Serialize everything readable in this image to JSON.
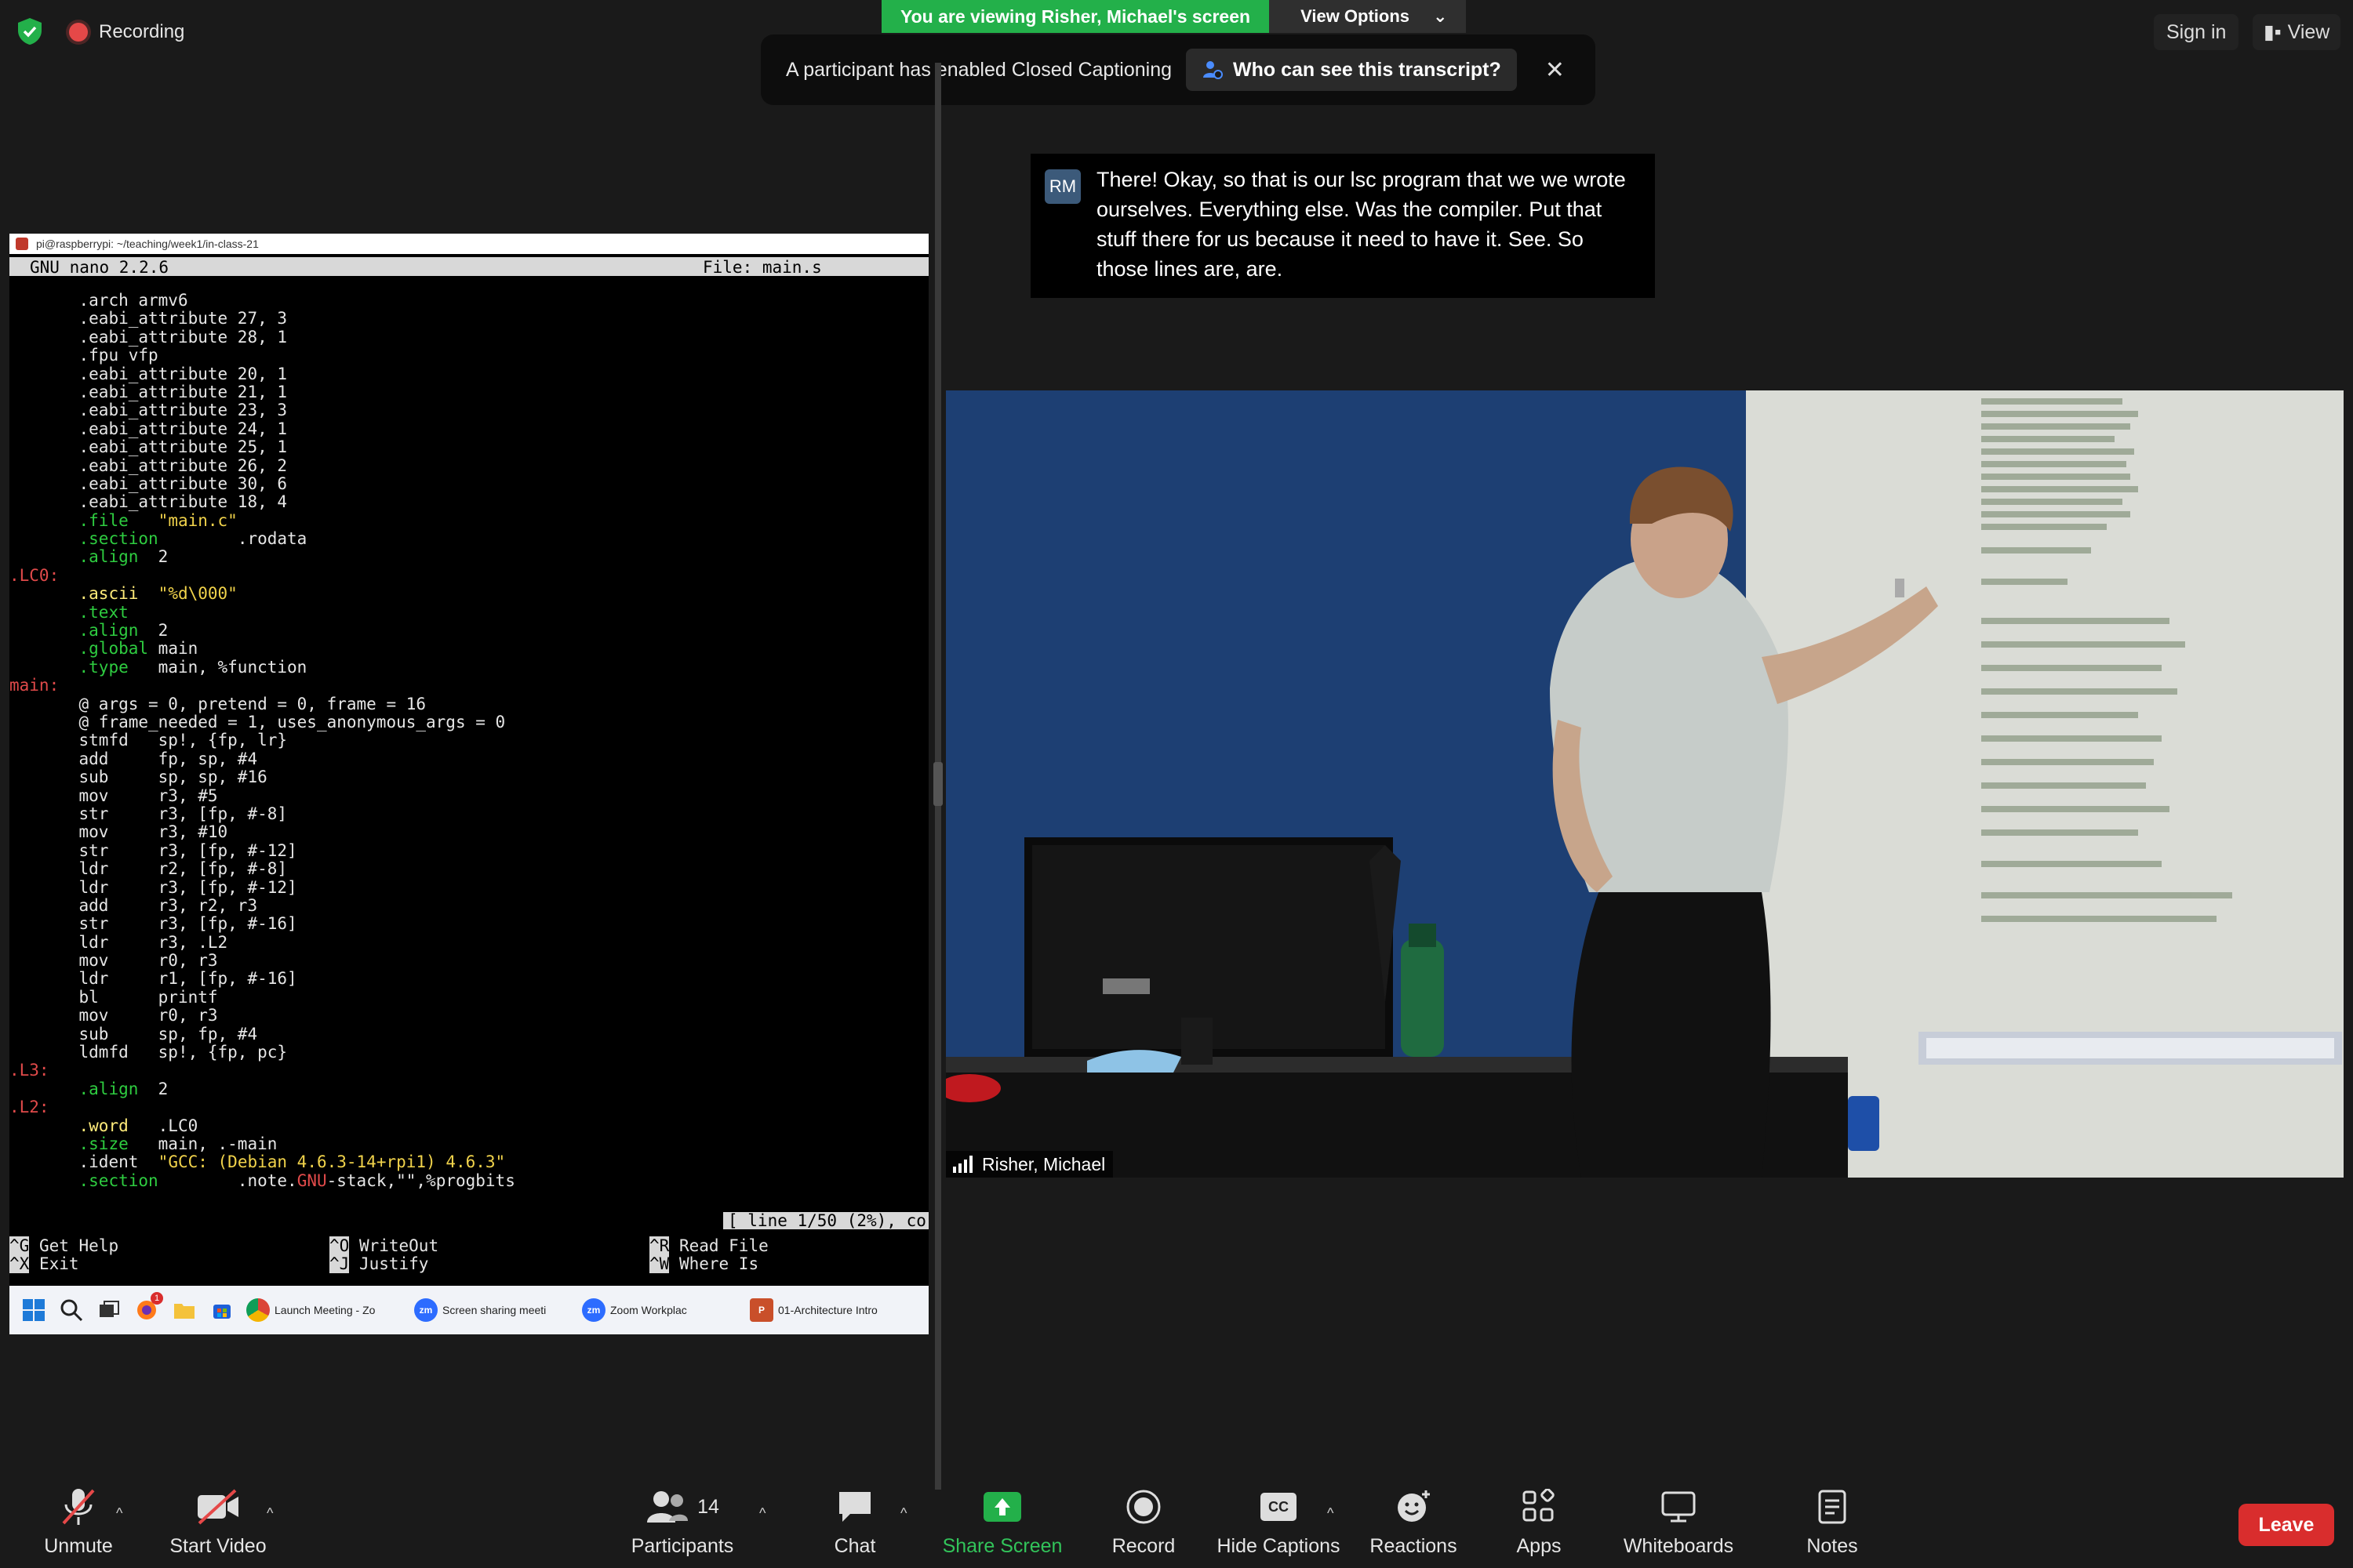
{
  "top": {
    "recording_label": "Recording",
    "viewing_banner": "You are viewing Risher, Michael's screen",
    "view_options": "View Options",
    "cc_notice": "A participant has enabled Closed Captioning",
    "cc_who": "Who can see this transcript?",
    "signin": "Sign in",
    "view": "View"
  },
  "terminal": {
    "title": "pi@raspberrypi: ~/teaching/week1/in-class-21",
    "nano_version": "GNU nano 2.2.6",
    "file": "File: main.s",
    "lines": [
      [
        [
          "",
          "       "
        ],
        [
          "t",
          ".arch armv6"
        ]
      ],
      [
        [
          "",
          "       "
        ],
        [
          "t",
          ".eabi_attribute 27, 3"
        ]
      ],
      [
        [
          "",
          "       "
        ],
        [
          "t",
          ".eabi_attribute 28, 1"
        ]
      ],
      [
        [
          "",
          "       "
        ],
        [
          "t",
          ".fpu vfp"
        ]
      ],
      [
        [
          "",
          "       "
        ],
        [
          "t",
          ".eabi_attribute 20, 1"
        ]
      ],
      [
        [
          "",
          "       "
        ],
        [
          "t",
          ".eabi_attribute 21, 1"
        ]
      ],
      [
        [
          "",
          "       "
        ],
        [
          "t",
          ".eabi_attribute 23, 3"
        ]
      ],
      [
        [
          "",
          "       "
        ],
        [
          "t",
          ".eabi_attribute 24, 1"
        ]
      ],
      [
        [
          "",
          "       "
        ],
        [
          "t",
          ".eabi_attribute 25, 1"
        ]
      ],
      [
        [
          "",
          "       "
        ],
        [
          "t",
          ".eabi_attribute 26, 2"
        ]
      ],
      [
        [
          "",
          "       "
        ],
        [
          "t",
          ".eabi_attribute 30, 6"
        ]
      ],
      [
        [
          "",
          "       "
        ],
        [
          "t",
          ".eabi_attribute 18, 4"
        ]
      ],
      [
        [
          "",
          "       "
        ],
        [
          "dir",
          ".file"
        ],
        [
          "t",
          "   "
        ],
        [
          "str",
          "\"main.c\""
        ]
      ],
      [
        [
          "",
          "       "
        ],
        [
          "dir",
          ".section"
        ],
        [
          "t",
          "        .rodata"
        ]
      ],
      [
        [
          "",
          "       "
        ],
        [
          "dir",
          ".align"
        ],
        [
          "t",
          "  2"
        ]
      ],
      [
        [
          "lab",
          ".LC0:"
        ]
      ],
      [
        [
          "",
          "       "
        ],
        [
          "kw",
          ".ascii"
        ],
        [
          "t",
          "  "
        ],
        [
          "str",
          "\"%d\\000\""
        ]
      ],
      [
        [
          "",
          "       "
        ],
        [
          "dir",
          ".text"
        ]
      ],
      [
        [
          "",
          "       "
        ],
        [
          "dir",
          ".align"
        ],
        [
          "t",
          "  2"
        ]
      ],
      [
        [
          "",
          "       "
        ],
        [
          "dir",
          ".global"
        ],
        [
          "t",
          " main"
        ]
      ],
      [
        [
          "",
          "       "
        ],
        [
          "dir",
          ".type"
        ],
        [
          "t",
          "   main, %function"
        ]
      ],
      [
        [
          "lab",
          "main:"
        ]
      ],
      [
        [
          "",
          "       "
        ],
        [
          "t",
          "@ args = 0, pretend = 0, frame = 16"
        ]
      ],
      [
        [
          "",
          "       "
        ],
        [
          "t",
          "@ frame_needed = 1, uses_anonymous_args = 0"
        ]
      ],
      [
        [
          "",
          "       "
        ],
        [
          "t",
          "stmfd   sp!, {fp, lr}"
        ]
      ],
      [
        [
          "",
          "       "
        ],
        [
          "t",
          "add     fp, sp, #4"
        ]
      ],
      [
        [
          "",
          "       "
        ],
        [
          "t",
          "sub     sp, sp, #16"
        ]
      ],
      [
        [
          "",
          "       "
        ],
        [
          "t",
          "mov     r3, #5"
        ]
      ],
      [
        [
          "",
          "       "
        ],
        [
          "t",
          "str     r3, [fp, #-8]"
        ]
      ],
      [
        [
          "",
          "       "
        ],
        [
          "t",
          "mov     r3, #10"
        ]
      ],
      [
        [
          "",
          "       "
        ],
        [
          "t",
          "str     r3, [fp, #-12]"
        ]
      ],
      [
        [
          "",
          "       "
        ],
        [
          "t",
          "ldr     r2, [fp, #-8]"
        ]
      ],
      [
        [
          "",
          "       "
        ],
        [
          "t",
          "ldr     r3, [fp, #-12]"
        ]
      ],
      [
        [
          "",
          "       "
        ],
        [
          "t",
          "add     r3, r2, r3"
        ]
      ],
      [
        [
          "",
          "       "
        ],
        [
          "t",
          "str     r3, [fp, #-16]"
        ]
      ],
      [
        [
          "",
          "       "
        ],
        [
          "t",
          "ldr     r3, .L2"
        ]
      ],
      [
        [
          "",
          "       "
        ],
        [
          "t",
          "mov     r0, r3"
        ]
      ],
      [
        [
          "",
          "       "
        ],
        [
          "t",
          "ldr     r1, [fp, #-16]"
        ]
      ],
      [
        [
          "",
          "       "
        ],
        [
          "t",
          "bl      printf"
        ]
      ],
      [
        [
          "",
          "       "
        ],
        [
          "t",
          "mov     r0, r3"
        ]
      ],
      [
        [
          "",
          "       "
        ],
        [
          "t",
          "sub     sp, fp, #4"
        ]
      ],
      [
        [
          "",
          "       "
        ],
        [
          "t",
          "ldmfd   sp!, {fp, pc}"
        ]
      ],
      [
        [
          "lab",
          ".L3:"
        ]
      ],
      [
        [
          "",
          "       "
        ],
        [
          "dir",
          ".align"
        ],
        [
          "t",
          "  2"
        ]
      ],
      [
        [
          "lab",
          ".L2:"
        ]
      ],
      [
        [
          "",
          "       "
        ],
        [
          "kw",
          ".word"
        ],
        [
          "t",
          "   .LC0"
        ]
      ],
      [
        [
          "",
          "       "
        ],
        [
          "dir",
          ".size"
        ],
        [
          "t",
          "   main, .-main"
        ]
      ],
      [
        [
          "",
          "       "
        ],
        [
          "t",
          ".ident  "
        ],
        [
          "str",
          "\"GCC: (Debian 4.6.3-14+rpi1) 4.6.3\""
        ]
      ],
      [
        [
          "",
          "       "
        ],
        [
          "dir",
          ".section"
        ],
        [
          "t",
          "        .note."
        ],
        [
          "lab",
          "GNU"
        ],
        [
          "t",
          "-stack,\"\",%progbits"
        ]
      ]
    ],
    "status": "[ line 1/50 (2%), co",
    "hotkeys": [
      {
        "key": "^G",
        "label": "Get Help"
      },
      {
        "key": "^X",
        "label": "Exit"
      },
      {
        "key": "^O",
        "label": "WriteOut"
      },
      {
        "key": "^J",
        "label": "Justify"
      },
      {
        "key": "^R",
        "label": "Read File"
      },
      {
        "key": "^W",
        "label": "Where Is"
      }
    ]
  },
  "taskbar": {
    "apps": [
      {
        "name": "Launch Meeting - Zo",
        "logo": "chrome-icon"
      },
      {
        "name": "Screen sharing meeti",
        "logo": "zoom-icon"
      },
      {
        "name": "Zoom Workplac",
        "logo": "zoom-icon"
      },
      {
        "name": "01-Architecture Intro",
        "logo": "powerpoint-icon"
      }
    ],
    "badge": "1"
  },
  "caption": {
    "initials": "RM",
    "text": "There! Okay, so that is our lsc program that we we wrote ourselves. Everything else. Was the compiler. Put that stuff there for us because it need to have it. See. So those lines are, are."
  },
  "video": {
    "name": "Risher, Michael"
  },
  "toolbar": {
    "unmute": "Unmute",
    "start_video": "Start Video",
    "participants": "Participants",
    "participants_count": "14",
    "chat": "Chat",
    "share_screen": "Share Screen",
    "record": "Record",
    "hide_captions": "Hide Captions",
    "cc": "CC",
    "reactions": "Reactions",
    "apps": "Apps",
    "whiteboards": "Whiteboards",
    "notes": "Notes",
    "leave": "Leave"
  },
  "colors": {
    "accent_green": "#23b04a",
    "leave_red": "#d92d2d",
    "recording_red": "#e54848"
  }
}
